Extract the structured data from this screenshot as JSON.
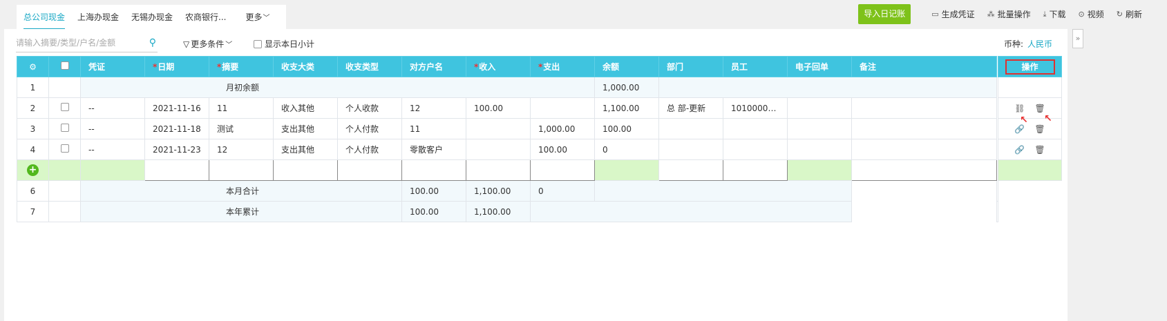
{
  "tabs": [
    {
      "label": "总公司现金",
      "active": true
    },
    {
      "label": "上海办现金"
    },
    {
      "label": "无锡办现金"
    },
    {
      "label": "农商银行..."
    },
    {
      "label": "更多"
    }
  ],
  "toolbar": {
    "import_label": "导入日记账",
    "voucher_label": "生成凭证",
    "batch_label": "批量操作",
    "download_label": "下载",
    "video_label": "视频",
    "refresh_label": "刷新"
  },
  "filter": {
    "search_placeholder": "请输入摘要/类型/户名/金额",
    "more_conditions": "更多条件",
    "show_daily_subtotal": "显示本日小计",
    "currency_label": "币种:",
    "currency_value": "人民币"
  },
  "table": {
    "headers": {
      "voucher": "凭证",
      "date": "日期",
      "summary": "摘要",
      "category": "收支大类",
      "type": "收支类型",
      "counterparty": "对方户名",
      "income": "收入",
      "expense": "支出",
      "balance": "余额",
      "department": "部门",
      "employee": "员工",
      "receipt": "电子回单",
      "remark": "备注",
      "action": "操作"
    },
    "opening": {
      "no": "1",
      "label": "月初余额",
      "balance": "1,000.00"
    },
    "rows": [
      {
        "no": "2",
        "voucher": "--",
        "date": "2021-11-16",
        "summary": "11",
        "category": "收入其他",
        "type": "个人收款",
        "counterparty": "12",
        "income": "100.00",
        "expense": "",
        "balance": "1,100.00",
        "department": "总 部-更新",
        "employee": "101000000...",
        "receipt": "",
        "remark": ""
      },
      {
        "no": "3",
        "voucher": "--",
        "date": "2021-11-18",
        "summary": "测试",
        "category": "支出其他",
        "type": "个人付款",
        "counterparty": "11",
        "income": "",
        "expense": "1,000.00",
        "balance": "100.00",
        "department": "",
        "employee": "",
        "receipt": "",
        "remark": ""
      },
      {
        "no": "4",
        "voucher": "--",
        "date": "2021-11-23",
        "summary": "12",
        "category": "支出其他",
        "type": "个人付款",
        "counterparty": "零散客户",
        "income": "",
        "expense": "100.00",
        "balance": "0",
        "department": "",
        "employee": "",
        "receipt": "",
        "remark": ""
      }
    ],
    "month_total": {
      "no": "6",
      "label": "本月合计",
      "income": "100.00",
      "expense": "1,100.00",
      "balance": "0"
    },
    "year_total": {
      "no": "7",
      "label": "本年累计",
      "income": "100.00",
      "expense": "1,100.00"
    },
    "colors": {
      "header_bg": "#3fc4df",
      "new_row_bg": "#d9f7c8",
      "accent": "#19a8c5",
      "primary_button": "#7ec21a",
      "highlight_border": "#e03030"
    }
  }
}
